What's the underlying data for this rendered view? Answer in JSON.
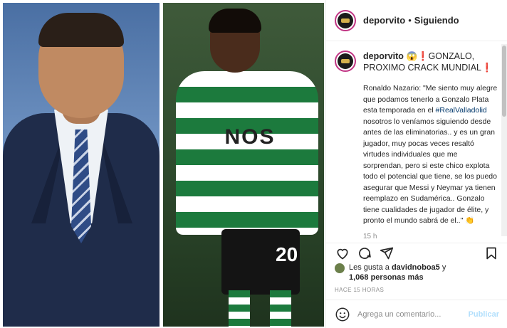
{
  "header": {
    "username": "deporvito",
    "separator": "•",
    "follow_status": "Siguiendo"
  },
  "caption": {
    "username": "deporvito",
    "title": "😱❗GONZALO, PROXIMO CRACK MUNDIAL❗",
    "body_before": "Ronaldo Nazario: \"Me siento muy alegre que podamos tenerlo a Gonzalo Plata esta temporada en el ",
    "hashtag": "#RealValladolid",
    "body_after": " nosotros lo veníamos siguiendo desde antes de las eliminatorias.. y es un gran jugador, muy pocas veces resaltó virtudes individuales que me sorprendan, pero si este chico explota todo el potencial que tiene, se los puedo asegurar que Messi y Neymar ya tienen reemplazo en Sudamérica.. Gonzalo tiene cualidades de jugador de élite, y pronto el mundo sabrá de el..\" 👏",
    "time": "15 h"
  },
  "media": {
    "jersey_text": "NOS",
    "jersey_number": "20"
  },
  "likes": {
    "prefix": "Les gusta a ",
    "user": "davidnoboa5",
    "middle": " y",
    "count": "1,068 personas más"
  },
  "timestamp": "HACE 15 HORAS",
  "comment": {
    "placeholder": "Agrega un comentario...",
    "publish_label": "Publicar"
  },
  "icons": {
    "like": "heart-icon",
    "comment": "comment-icon",
    "share": "share-icon",
    "save": "bookmark-icon",
    "emoji": "emoji-icon"
  },
  "colors": {
    "story_ring": "#c13584",
    "link": "#00376b",
    "publish_disabled": "#b2dffc",
    "muted": "#8e8e8e"
  }
}
